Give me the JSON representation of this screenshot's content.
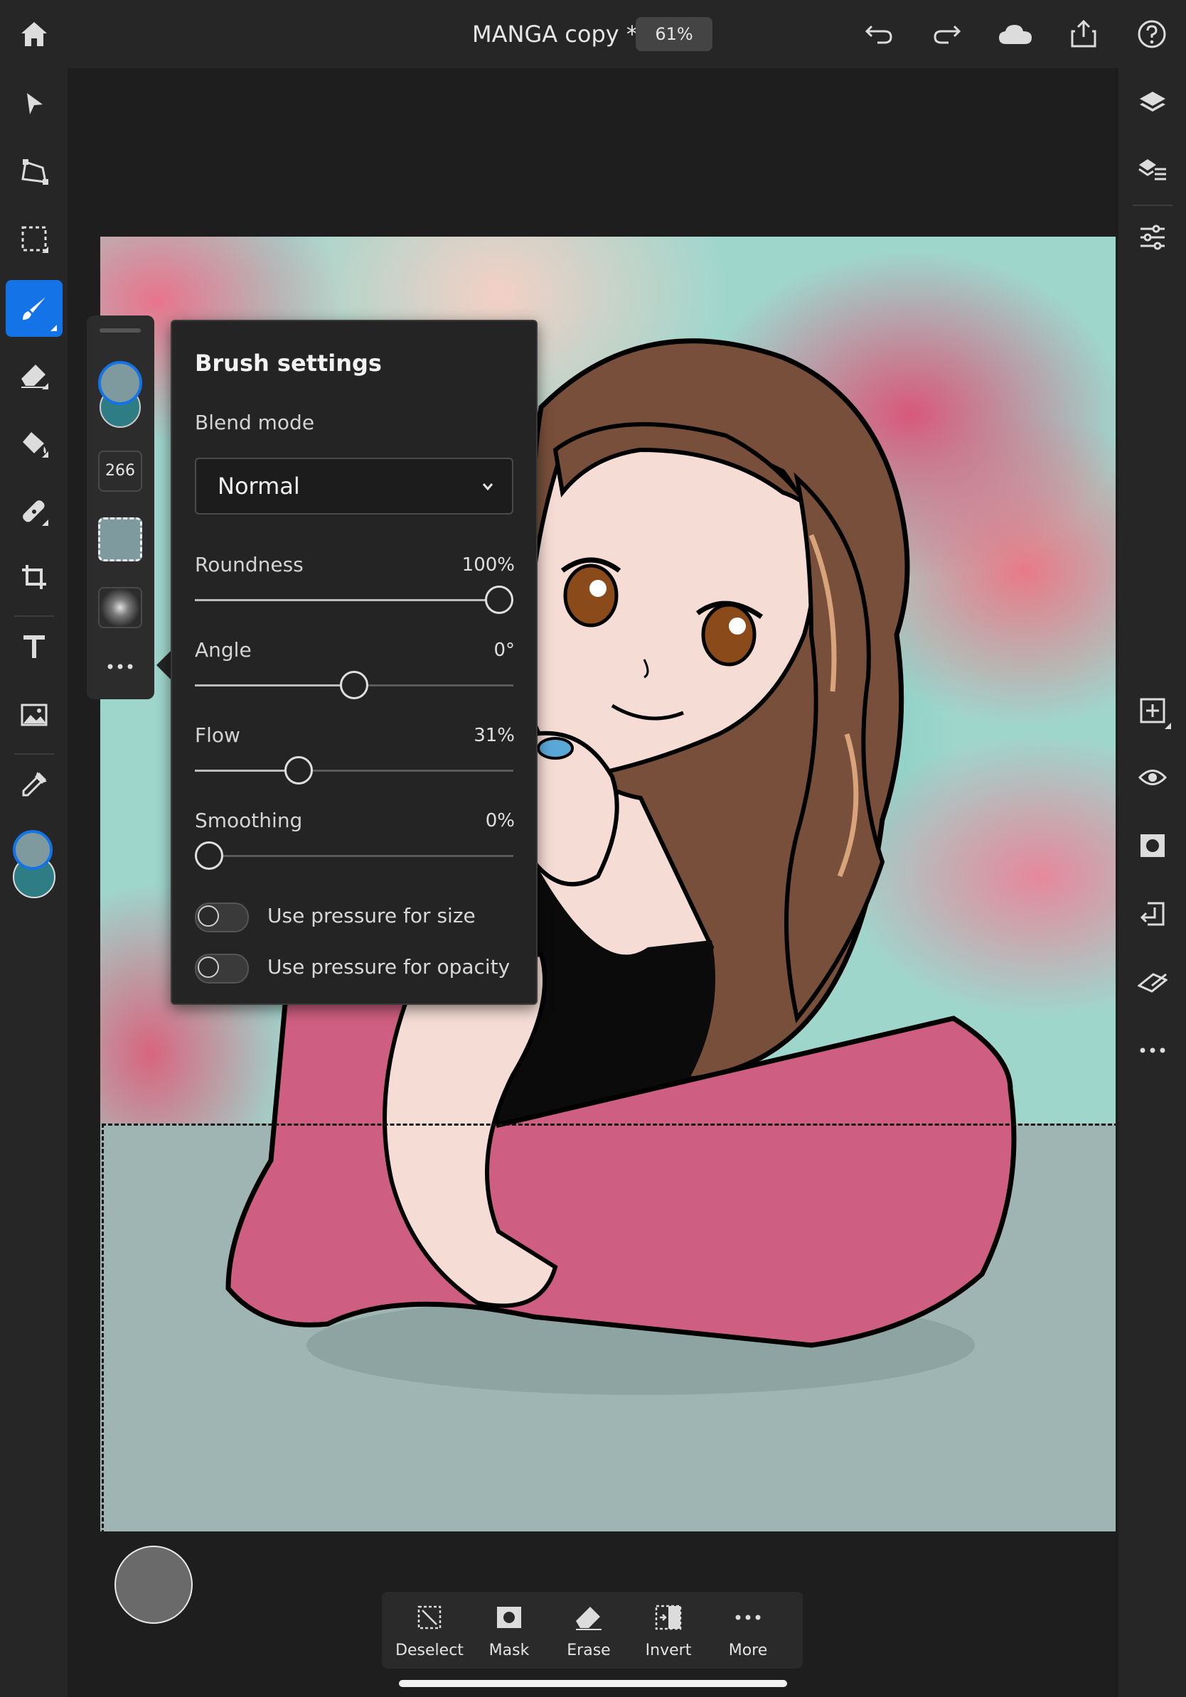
{
  "topbar": {
    "doc_title": "MANGA copy *",
    "zoom": "61%",
    "icons": [
      "home-icon",
      "undo-icon",
      "redo-icon",
      "cloud-icon",
      "share-icon",
      "help-icon"
    ]
  },
  "left_toolbar": {
    "tools": [
      "move-tool",
      "transform-tool",
      "selection-tool",
      "brush-tool",
      "eraser-tool",
      "fill-tool",
      "healing-tool",
      "crop-tool",
      "type-tool",
      "image-tool",
      "eyedropper-tool",
      "color-swatches"
    ],
    "active_tool": "brush-tool",
    "foreground_color": "#7e9a9e",
    "background_color": "#2f7d84"
  },
  "brush_dock": {
    "size": "266",
    "foreground_color": "#7e9a9e",
    "background_color": "#2f7d84"
  },
  "brush_settings": {
    "title": "Brush settings",
    "blend_mode_label": "Blend mode",
    "blend_mode_value": "Normal",
    "roundness": {
      "label": "Roundness",
      "value": "100%",
      "fraction": 1.0
    },
    "angle": {
      "label": "Angle",
      "value": "0°",
      "fraction": 0.5
    },
    "flow": {
      "label": "Flow",
      "value": "31%",
      "fraction": 0.31
    },
    "smoothing": {
      "label": "Smoothing",
      "value": "0%",
      "fraction": 0.0
    },
    "pressure_size": {
      "label": "Use pressure for size",
      "on": false
    },
    "pressure_opacity": {
      "label": "Use pressure for opacity",
      "on": false
    }
  },
  "right_toolbar": {
    "icons": [
      "layers-icon",
      "layer-properties-icon",
      "adjustments-icon",
      "add-layer-icon",
      "visibility-icon",
      "mask-icon",
      "merge-down-icon",
      "clear-icon",
      "more-icon"
    ]
  },
  "selection_toolbar": {
    "buttons": [
      {
        "label": "Deselect",
        "icon": "deselect-icon"
      },
      {
        "label": "Mask",
        "icon": "mask-icon"
      },
      {
        "label": "Erase",
        "icon": "erase-icon"
      },
      {
        "label": "Invert",
        "icon": "invert-icon"
      },
      {
        "label": "More",
        "icon": "more-icon"
      }
    ]
  },
  "colors": {
    "accent": "#1473e6",
    "panel_bg": "#242424",
    "toolbar_bg": "#262626"
  }
}
